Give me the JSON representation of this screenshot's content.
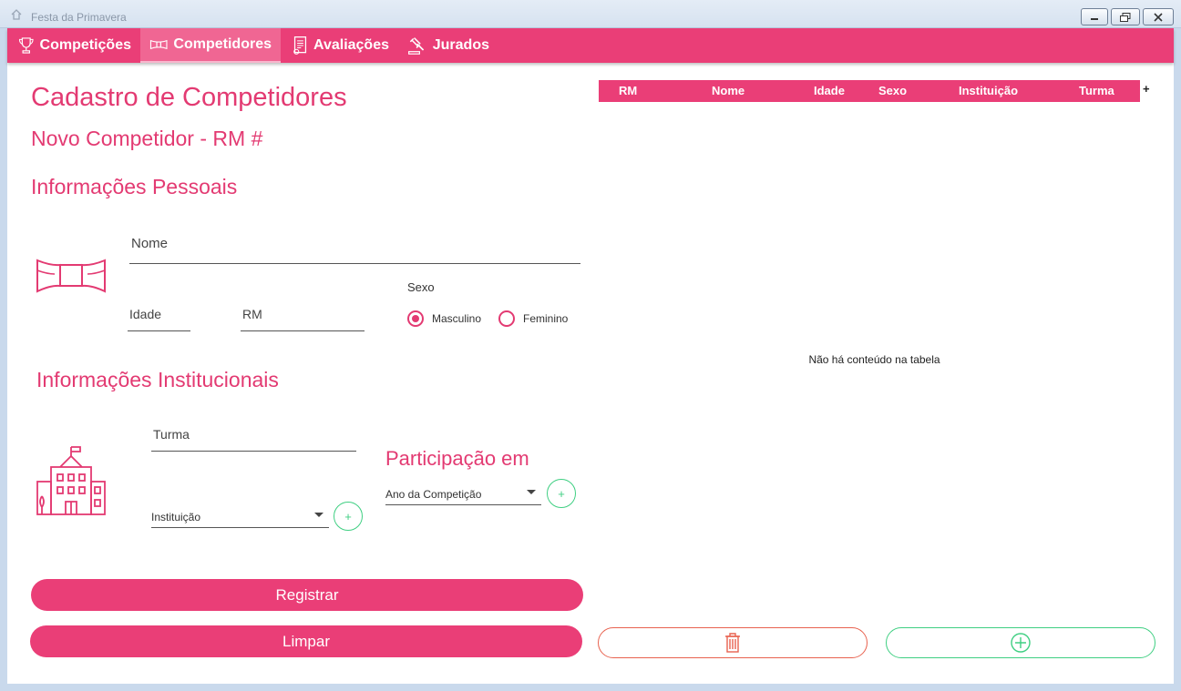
{
  "window": {
    "title": "Festa da Primavera"
  },
  "nav": {
    "tabs": [
      {
        "label": "Competições",
        "icon": "trophy-icon"
      },
      {
        "label": "Competidores",
        "icon": "bowtie-icon",
        "active": true
      },
      {
        "label": "Avaliações",
        "icon": "document-icon"
      },
      {
        "label": "Jurados",
        "icon": "gavel-icon"
      }
    ]
  },
  "form": {
    "title": "Cadastro de Competidores",
    "subtitle": "Novo Competidor - RM #",
    "personal": {
      "heading": "Informações Pessoais",
      "nome_placeholder": "Nome",
      "idade_placeholder": "Idade",
      "rm_placeholder": "RM",
      "sexo_label": "Sexo",
      "sexo_options": [
        "Masculino",
        "Feminino"
      ],
      "sexo_selected": "Masculino"
    },
    "institutional": {
      "heading": "Informações Institucionais",
      "turma_placeholder": "Turma",
      "instituicao_placeholder": "Instituição",
      "add_symbol": "+"
    },
    "participation": {
      "heading": "Participação em",
      "ano_placeholder": "Ano da Competição",
      "add_symbol": "+"
    },
    "buttons": {
      "register": "Registrar",
      "clear": "Limpar"
    }
  },
  "table": {
    "columns": [
      "RM",
      "Nome",
      "Idade",
      "Sexo",
      "Instituição",
      "Turma"
    ],
    "add_column_symbol": "+",
    "empty_message": "Não há conteúdo na tabela",
    "rows": []
  },
  "colors": {
    "primary": "#ea3e77",
    "success": "#3fcf82",
    "danger": "#e8624f"
  }
}
